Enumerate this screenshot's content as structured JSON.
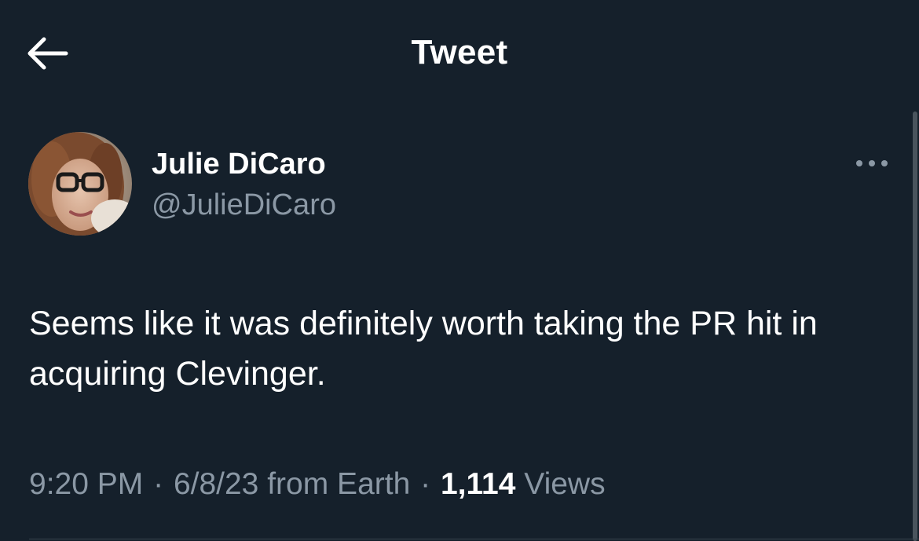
{
  "header": {
    "title": "Tweet",
    "back_icon": "arrow-left-icon"
  },
  "tweet": {
    "author_name": "Julie DiCaro",
    "author_handle": "@JulieDiCaro",
    "more_icon": "more-horizontal-icon",
    "text": "Seems like it was definitely worth taking the PR hit in acquiring Clevinger.",
    "time": "9:20 PM",
    "date": "6/8/23",
    "source": "from Earth",
    "separator": "·",
    "views_count": "1,114",
    "views_label": "Views"
  },
  "colors": {
    "background": "#15202b",
    "primary_text": "#ffffff",
    "secondary_text": "#8b98a5",
    "divider": "#38444d"
  }
}
